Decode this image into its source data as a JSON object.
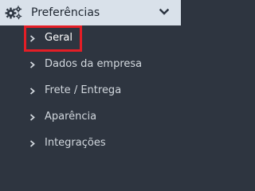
{
  "menu": {
    "header": {
      "label": "Preferências",
      "icon": "gears-icon",
      "chevron": "chevron-down-icon",
      "background": "#d9e1ea"
    },
    "items": [
      {
        "label": "Geral",
        "icon": "chevron-right-icon",
        "active": true
      },
      {
        "label": "Dados da empresa",
        "icon": "chevron-right-icon",
        "active": false
      },
      {
        "label": "Frete / Entrega",
        "icon": "chevron-right-icon",
        "active": false
      },
      {
        "label": "Aparência",
        "icon": "chevron-right-icon",
        "active": false
      },
      {
        "label": "Integrações",
        "icon": "chevron-right-icon",
        "active": false
      }
    ],
    "background": "#2e3540",
    "highlight_color": "#e41e26"
  }
}
